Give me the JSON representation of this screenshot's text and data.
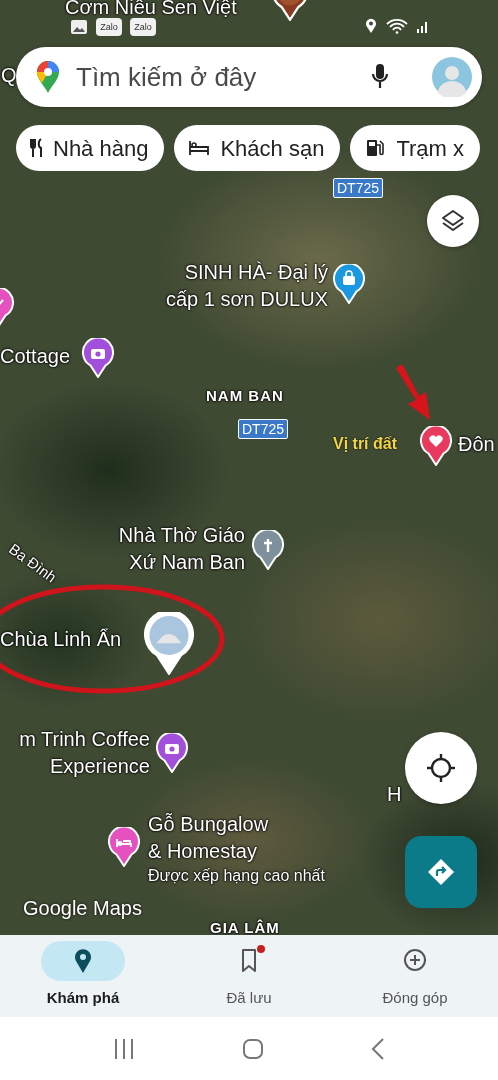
{
  "status_bar": {
    "notifications": [
      {
        "kind": "gallery"
      },
      {
        "kind": "app",
        "label": "Zalo"
      },
      {
        "kind": "app",
        "label": "Zalo"
      }
    ]
  },
  "search": {
    "placeholder": "Tìm kiếm ở đây"
  },
  "chips": [
    {
      "kind": "restaurant",
      "label": "Nhà hàng"
    },
    {
      "kind": "hotel",
      "label": "Khách sạn"
    },
    {
      "kind": "fuel",
      "label": "Trạm x"
    }
  ],
  "map": {
    "labels": [
      {
        "kind": "place",
        "lines": [
          "Cơm Niêu Sen Việt"
        ],
        "pin": {
          "kind": "photo-dark"
        }
      },
      {
        "kind": "place",
        "lines": [
          "Q"
        ]
      },
      {
        "kind": "shield",
        "lines": [
          "DT725"
        ]
      },
      {
        "kind": "place",
        "lines": [
          "SINH HÀ- Đại lý",
          "cấp 1 sơn DULUX"
        ],
        "pin": {
          "kind": "shopping"
        }
      },
      {
        "kind": "pin",
        "pin": {
          "kind": "attraction"
        }
      },
      {
        "kind": "place",
        "lines": [
          "Cottage"
        ],
        "pin": {
          "kind": "camera"
        }
      },
      {
        "kind": "area",
        "lines": [
          "NAM BAN"
        ]
      },
      {
        "kind": "shield",
        "lines": [
          "DT725"
        ]
      },
      {
        "kind": "place",
        "lines": [
          "Đôn"
        ],
        "pin": {
          "kind": "heart"
        }
      },
      {
        "kind": "road",
        "lines": [
          "Ba Đình"
        ]
      },
      {
        "kind": "place",
        "lines": [
          "Nhà Thờ Giáo",
          "Xứ Nam Ban"
        ],
        "pin": {
          "kind": "church"
        }
      },
      {
        "kind": "place",
        "lines": [
          "Chùa Linh Ẩn"
        ],
        "pin": {
          "kind": "photo"
        }
      },
      {
        "kind": "place",
        "lines": [
          "m Trinh Coffee",
          "Experience"
        ],
        "pin": {
          "kind": "camera"
        }
      },
      {
        "kind": "place",
        "lines": [
          "H"
        ]
      },
      {
        "kind": "place",
        "lines": [
          "Gỗ Bungalow",
          "& Homestay"
        ],
        "subtitle": "Được xếp hạng cao nhất",
        "pin": {
          "kind": "hotel"
        }
      },
      {
        "kind": "area",
        "lines": [
          "GIA LÂM"
        ]
      }
    ],
    "annotations": [
      {
        "kind": "arrow"
      },
      {
        "kind": "text",
        "text": "Vị trí đất"
      },
      {
        "kind": "ellipse"
      }
    ],
    "logo": "Google Maps"
  },
  "bottom_nav": [
    {
      "kind": "explore",
      "label": "Khám phá",
      "selected": true,
      "dot": false
    },
    {
      "kind": "saved",
      "label": "Đã lưu",
      "selected": false,
      "dot": true
    },
    {
      "kind": "contribute",
      "label": "Đóng góp",
      "selected": false,
      "dot": false
    }
  ]
}
